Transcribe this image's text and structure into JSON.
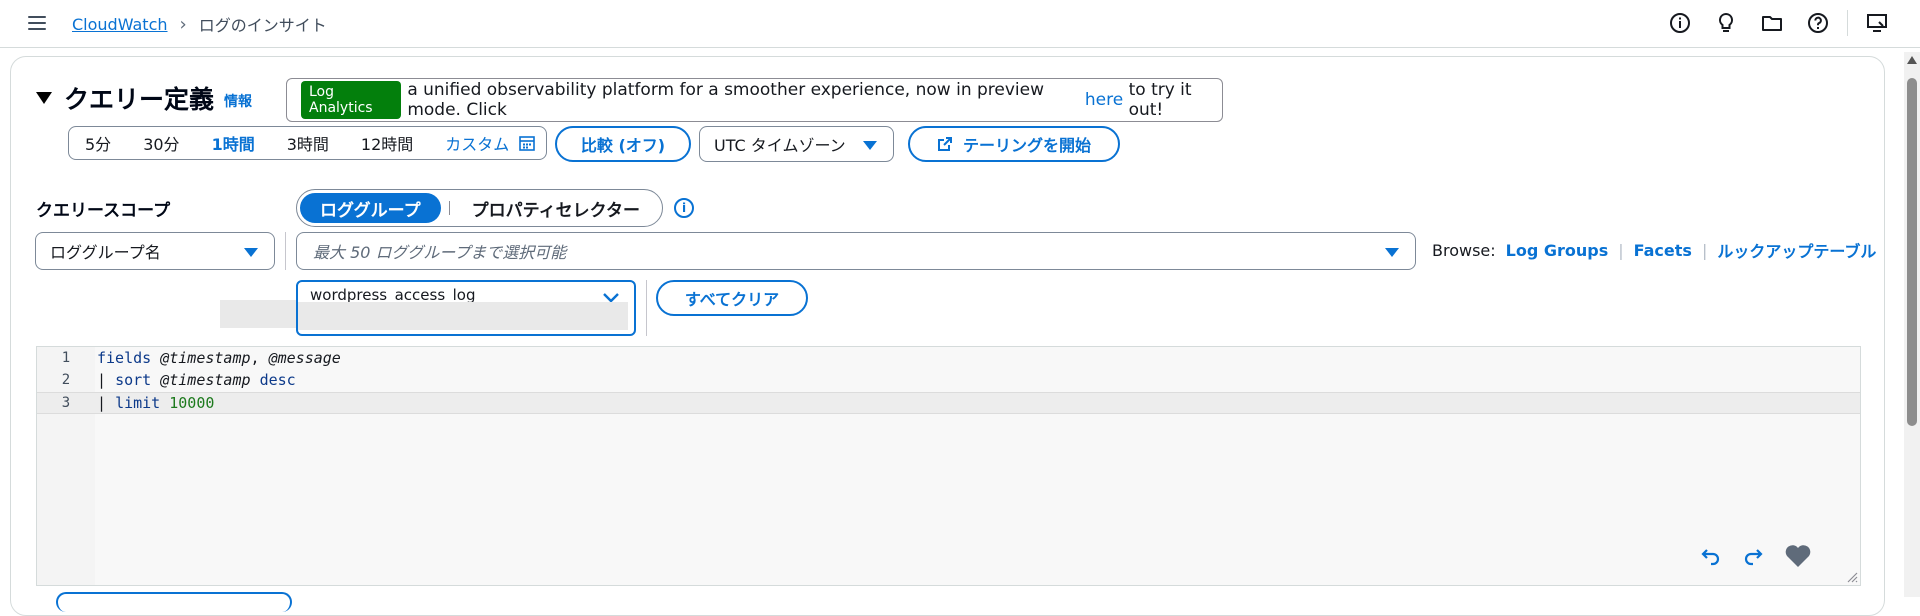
{
  "breadcrumb": {
    "root": "CloudWatch",
    "current": "ログのインサイト"
  },
  "top_icons": [
    "info-icon",
    "lightbulb-icon",
    "folder-icon",
    "help-icon",
    "screen-icon"
  ],
  "query": {
    "title": "クエリー定義",
    "info_label": "情報",
    "banner": {
      "badge": "Log Analytics",
      "text": "a unified observability platform for a smoother experience, now in preview mode. Click",
      "link": "here",
      "suffix": "to try it out!"
    },
    "time_ranges": [
      "5分",
      "30分",
      "1時間",
      "3時間",
      "12時間"
    ],
    "time_active": "1時間",
    "custom_label": "カスタム",
    "compare_label": "比較 (オフ)",
    "timezone": "UTC タイムゾーン",
    "tail_label": "テーリングを開始"
  },
  "scope": {
    "label": "クエリースコープ",
    "toggle_on": "ロググループ",
    "toggle_off": "プロパティセレクター",
    "filter_select": "ロググループ名",
    "placeholder": "最大 50 ロググループまで選択可能",
    "browse_label": "Browse:",
    "browse_links": [
      "Log Groups",
      "Facets",
      "ルックアップテーブル"
    ],
    "selected_token": "wordpress_access_log",
    "clear_all": "すべてクリア"
  },
  "editor": {
    "lines": [
      {
        "no": "1",
        "kw": "fields",
        "rest_a": "@timestamp",
        "rest_b": ", ",
        "rest_c": "@message"
      },
      {
        "no": "2",
        "pipe": "| ",
        "kw": "sort",
        "var": "@timestamp",
        "tail": "desc"
      },
      {
        "no": "3",
        "pipe": "| ",
        "kw": "limit",
        "num": "10000"
      }
    ]
  },
  "colors": {
    "accent": "#0972d3",
    "badge": "#037f0c",
    "border": "#7d8998"
  }
}
